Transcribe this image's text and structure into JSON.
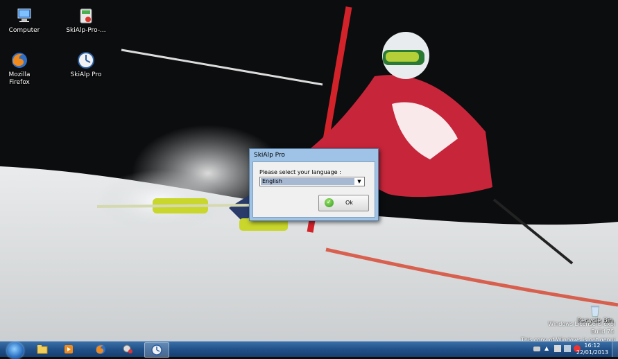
{
  "desktop": {
    "icons": [
      {
        "label": "Computer",
        "icon": "computer-icon"
      },
      {
        "label": "SkiAlp-Pro-...",
        "icon": "installer-icon"
      },
      {
        "label": "Mozilla Firefox",
        "icon": "firefox-icon"
      },
      {
        "label": "SkiAlp Pro",
        "icon": "skialp-icon"
      },
      {
        "label": "Recycle Bin",
        "icon": "recycle-bin-icon"
      }
    ]
  },
  "dialog": {
    "title": "SkiAlp Pro",
    "prompt": "Please select your language :",
    "language_selected": "English",
    "ok_label": "Ok"
  },
  "watermark": {
    "line1": "Windows License is expi",
    "line2": "Build 76",
    "line3": "This copy of Windows is not genui"
  },
  "taskbar": {
    "items": [
      "explorer-icon",
      "media-player-icon",
      "firefox-icon",
      "network-icon",
      "skialp-icon"
    ],
    "clock_time": "16:12",
    "clock_date": "22/01/2013"
  },
  "colors": {
    "taskbar": "#1f4e86",
    "dialog_frame": "#9ec3e6",
    "slalom_gate": "#d3232a"
  }
}
